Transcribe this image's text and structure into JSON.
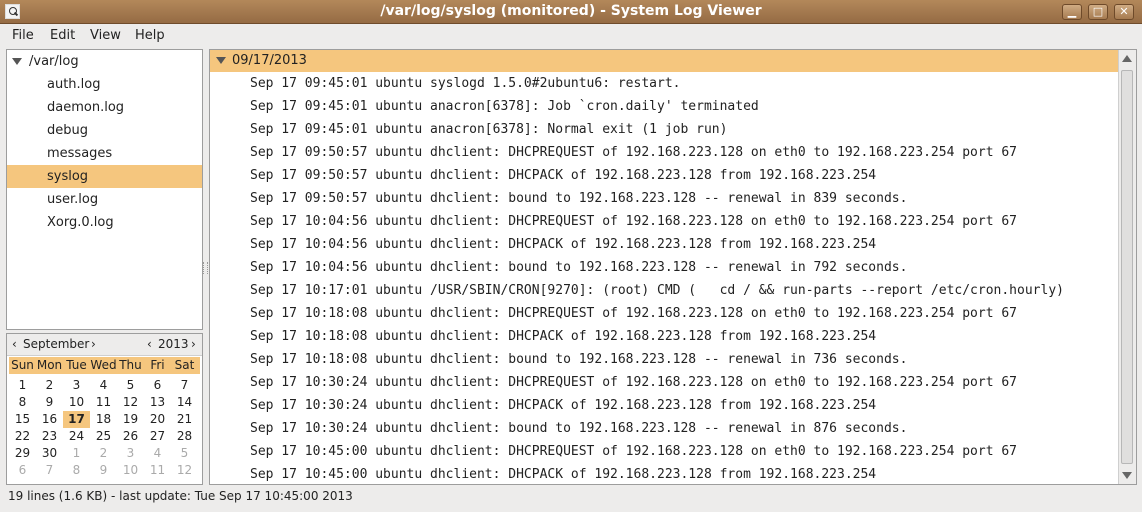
{
  "window": {
    "title": "/var/log/syslog (monitored) - System Log Viewer",
    "buttons": [
      "minimize",
      "maximize",
      "close"
    ]
  },
  "menu": [
    {
      "label": "File"
    },
    {
      "label": "Edit"
    },
    {
      "label": "View"
    },
    {
      "label": "Help"
    }
  ],
  "tree": {
    "root": "/var/log",
    "items": [
      "auth.log",
      "daemon.log",
      "debug",
      "messages",
      "syslog",
      "user.log",
      "Xorg.0.log"
    ],
    "selected": "syslog"
  },
  "calendar": {
    "month": "September",
    "year": "2013",
    "dows": [
      "Sun",
      "Mon",
      "Tue",
      "Wed",
      "Thu",
      "Fri",
      "Sat"
    ],
    "weeks": [
      [
        "1",
        "2",
        "3",
        "4",
        "5",
        "6",
        "7"
      ],
      [
        "8",
        "9",
        "10",
        "11",
        "12",
        "13",
        "14"
      ],
      [
        "15",
        "16",
        "17",
        "18",
        "19",
        "20",
        "21"
      ],
      [
        "22",
        "23",
        "24",
        "25",
        "26",
        "27",
        "28"
      ],
      [
        "29",
        "30",
        "1",
        "2",
        "3",
        "4",
        "5"
      ],
      [
        "6",
        "7",
        "8",
        "9",
        "10",
        "11",
        "12"
      ]
    ],
    "today": "17"
  },
  "log": {
    "date": "09/17/2013",
    "lines": [
      "Sep 17 09:45:01 ubuntu syslogd 1.5.0#2ubuntu6: restart.",
      "Sep 17 09:45:01 ubuntu anacron[6378]: Job `cron.daily' terminated",
      "Sep 17 09:45:01 ubuntu anacron[6378]: Normal exit (1 job run)",
      "Sep 17 09:50:57 ubuntu dhclient: DHCPREQUEST of 192.168.223.128 on eth0 to 192.168.223.254 port 67",
      "Sep 17 09:50:57 ubuntu dhclient: DHCPACK of 192.168.223.128 from 192.168.223.254",
      "Sep 17 09:50:57 ubuntu dhclient: bound to 192.168.223.128 -- renewal in 839 seconds.",
      "Sep 17 10:04:56 ubuntu dhclient: DHCPREQUEST of 192.168.223.128 on eth0 to 192.168.223.254 port 67",
      "Sep 17 10:04:56 ubuntu dhclient: DHCPACK of 192.168.223.128 from 192.168.223.254",
      "Sep 17 10:04:56 ubuntu dhclient: bound to 192.168.223.128 -- renewal in 792 seconds.",
      "Sep 17 10:17:01 ubuntu /USR/SBIN/CRON[9270]: (root) CMD (   cd / && run-parts --report /etc/cron.hourly)",
      "Sep 17 10:18:08 ubuntu dhclient: DHCPREQUEST of 192.168.223.128 on eth0 to 192.168.223.254 port 67",
      "Sep 17 10:18:08 ubuntu dhclient: DHCPACK of 192.168.223.128 from 192.168.223.254",
      "Sep 17 10:18:08 ubuntu dhclient: bound to 192.168.223.128 -- renewal in 736 seconds.",
      "Sep 17 10:30:24 ubuntu dhclient: DHCPREQUEST of 192.168.223.128 on eth0 to 192.168.223.254 port 67",
      "Sep 17 10:30:24 ubuntu dhclient: DHCPACK of 192.168.223.128 from 192.168.223.254",
      "Sep 17 10:30:24 ubuntu dhclient: bound to 192.168.223.128 -- renewal in 876 seconds.",
      "Sep 17 10:45:00 ubuntu dhclient: DHCPREQUEST of 192.168.223.128 on eth0 to 192.168.223.254 port 67",
      "Sep 17 10:45:00 ubuntu dhclient: DHCPACK of 192.168.223.128 from 192.168.223.254"
    ]
  },
  "status": "19 lines (1.6 KB) - last update: Tue Sep 17 10:45:00 2013",
  "colors": {
    "titlebar": "#a57a50",
    "selection": "#f5c67e",
    "background": "#edeceb"
  }
}
